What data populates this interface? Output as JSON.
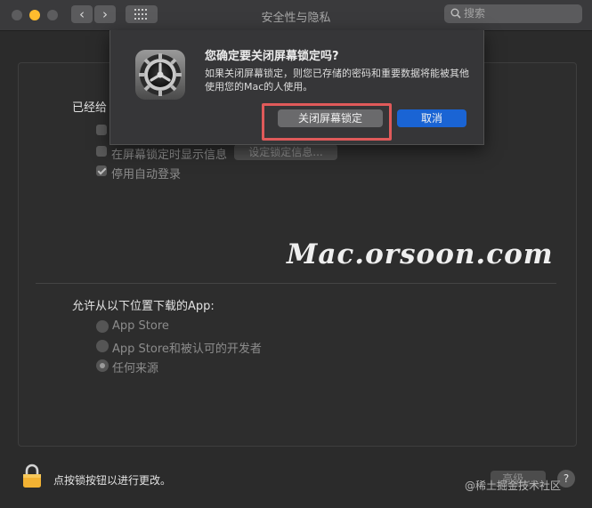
{
  "window": {
    "title": "安全性与隐私",
    "back_glyph": "‹",
    "forward_glyph": "›",
    "search_placeholder": "搜索"
  },
  "general": {
    "header_partial": "已经给",
    "show_message_label": "在屏幕锁定时显示信息",
    "set_message_button": "设定锁定信息...",
    "disable_autologin_label": "停用自动登录"
  },
  "downloads": {
    "header": "允许从以下位置下载的App:",
    "options": [
      {
        "label": "App Store",
        "selected": false
      },
      {
        "label": "App Store和被认可的开发者",
        "selected": false
      },
      {
        "label": "任何来源",
        "selected": true
      }
    ]
  },
  "dialog": {
    "title": "您确定要关闭屏幕锁定吗?",
    "message": "如果关闭屏幕锁定，则您已存储的密码和重要数据将能被其他使用您的Mac的人使用。",
    "confirm_button": "关闭屏幕锁定",
    "cancel_button": "取消"
  },
  "footer": {
    "lock_text": "点按锁按钮以进行更改。",
    "advanced_button": "高级...",
    "help_glyph": "?"
  },
  "watermark": "Mac.orsoon.com",
  "credit": "@稀土掘金技术社区",
  "colors": {
    "accent": "#1a64d4",
    "highlight": "#e05a5a",
    "minimize": "#febc2e"
  }
}
